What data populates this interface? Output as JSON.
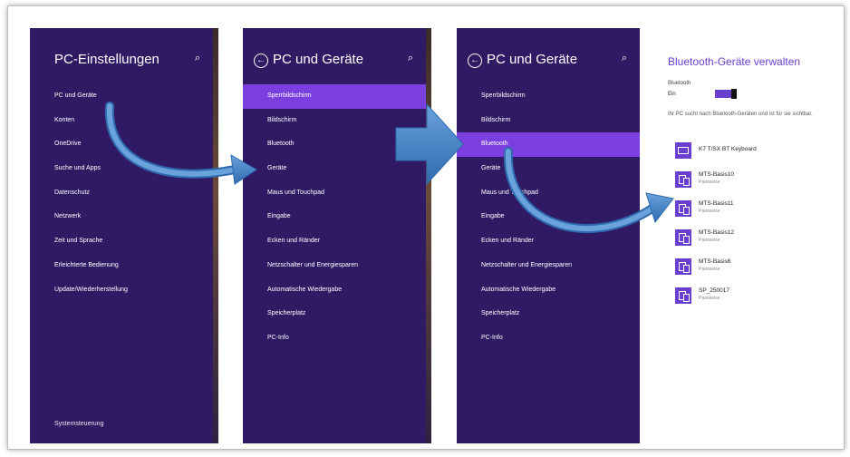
{
  "panel1": {
    "title": "PC-Einstellungen",
    "search_icon": "search-icon",
    "items": [
      "PC und Geräte",
      "Konten",
      "OneDrive",
      "Suche und Apps",
      "Datenschutz",
      "Netzwerk",
      "Zeit und Sprache",
      "Erleichterte Bedienung",
      "Update/Wiederherstellung"
    ],
    "footer": "Systemsteuerung"
  },
  "panel2": {
    "title": "PC und Geräte",
    "items": [
      "Sperrbildschirm",
      "Bildschirm",
      "Bluetooth",
      "Geräte",
      "Maus und Touchpad",
      "Eingabe",
      "Ecken und Ränder",
      "Netzschalter und Energiesparen",
      "Automatische Wiedergabe",
      "Speicherplatz",
      "PC-Info"
    ],
    "selected_index": 0
  },
  "panel3": {
    "title": "PC und Geräte",
    "items": [
      "Sperrbildschirm",
      "Bildschirm",
      "Bluetooth",
      "Geräte",
      "Maus und Touchpad",
      "Eingabe",
      "Ecken und Ränder",
      "Netzschalter und Energiesparen",
      "Automatische Wiedergabe",
      "Speicherplatz",
      "PC-Info"
    ],
    "selected_index": 2
  },
  "bluetooth": {
    "title": "Bluetooth-Geräte verwalten",
    "toggle_label": "Bluetooth",
    "toggle_state": "Ein",
    "toggle_on": true,
    "description": "Ihr PC sucht nach Bluetooth-Geräten und ist für sie sichtbar.",
    "devices": [
      {
        "name": "K7 T/SX BT Keyboard",
        "status": "",
        "icon": "keyboard-icon"
      },
      {
        "name": "MTS-Basis10",
        "status": "Paarweise",
        "icon": "device-icon"
      },
      {
        "name": "MTS-Basis11",
        "status": "Paarweise",
        "icon": "device-icon"
      },
      {
        "name": "MTS-Basis12",
        "status": "Paarweise",
        "icon": "device-icon"
      },
      {
        "name": "MTS-Basis6",
        "status": "Paarweise",
        "icon": "device-icon"
      },
      {
        "name": "SP_250017",
        "status": "Paarweise",
        "icon": "device-icon"
      }
    ]
  },
  "colors": {
    "panel_bg": "#2f1a63",
    "selected_bg": "#7b3fe0",
    "accent": "#6a3fd0",
    "arrow": "#4a86c8"
  }
}
